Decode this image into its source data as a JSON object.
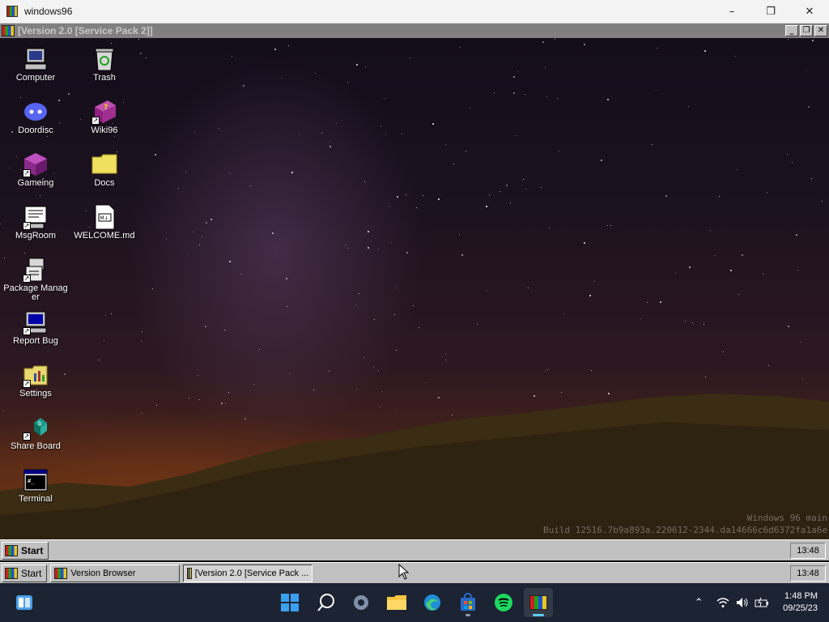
{
  "host_window": {
    "title": "windows96",
    "controls": {
      "minimize": "–",
      "restore": "❐",
      "close": "✕"
    }
  },
  "w96_window": {
    "title": "[Version 2.0 [Service Pack 2]]",
    "buttons": {
      "minimize": "_",
      "restore": "❐",
      "close": "✕"
    }
  },
  "desktop": {
    "icons": [
      {
        "label": "Computer",
        "icon": "computer-icon"
      },
      {
        "label": "Trash",
        "icon": "recycle-bin-icon"
      },
      {
        "label": "Doordisc",
        "icon": "discord-icon"
      },
      {
        "label": "Wiki96",
        "icon": "book-icon"
      },
      {
        "label": "Gameing",
        "icon": "cube-icon"
      },
      {
        "label": "Docs",
        "icon": "folder-icon"
      },
      {
        "label": "MsgRoom",
        "icon": "message-board-icon"
      },
      {
        "label": "WELCOME.md",
        "icon": "markdown-file-icon"
      },
      {
        "label": "Package Manager",
        "icon": "package-icon"
      },
      {
        "label": "Report Bug",
        "icon": "monitor-bug-icon"
      },
      {
        "label": "Settings",
        "icon": "settings-folder-icon"
      },
      {
        "label": "Share Board",
        "icon": "share-board-icon"
      },
      {
        "label": "Terminal",
        "icon": "terminal-icon"
      }
    ],
    "build_info": {
      "line1": "Windows 96 main",
      "line2": "Build 12516.7b9a893a.220612-2344.da14666c6d6372fa1a6e"
    }
  },
  "w96_taskbar_top": {
    "start_label": "Start",
    "clock": "13:48"
  },
  "w96_taskbar_bottom": {
    "start_label": "Start",
    "tasks": [
      {
        "label": "Version Browser"
      },
      {
        "label": "[Version 2.0 [Service Pack ..."
      }
    ],
    "clock": "13:48"
  },
  "win_taskbar": {
    "apps": [
      {
        "name": "start-menu",
        "icon": "windows-logo-icon"
      },
      {
        "name": "search",
        "icon": "search-icon"
      },
      {
        "name": "settings",
        "icon": "gear-icon"
      },
      {
        "name": "file-explorer",
        "icon": "folder-icon"
      },
      {
        "name": "edge",
        "icon": "edge-browser-icon"
      },
      {
        "name": "store",
        "icon": "store-icon"
      },
      {
        "name": "spotify",
        "icon": "spotify-icon"
      },
      {
        "name": "windows96",
        "icon": "windows96-icon"
      }
    ],
    "tray": {
      "time": "1:48 PM",
      "date": "09/25/23"
    }
  },
  "colors": {
    "w96_face": "#c0c0c0",
    "w96_title_inactive": "#808080",
    "win11_taskbar": "#1c2433",
    "accent": "#60cdff"
  }
}
